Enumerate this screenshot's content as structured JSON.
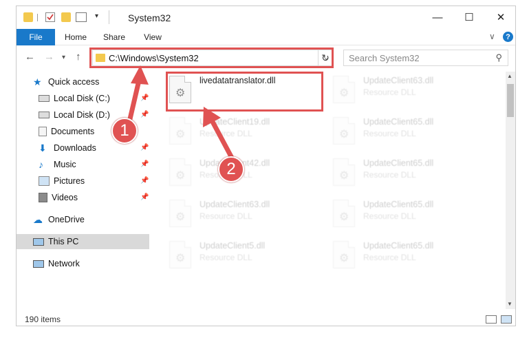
{
  "titlebar": {
    "title": "System32",
    "minimize": "—",
    "maximize": "☐",
    "close": "✕"
  },
  "ribbon": {
    "tabs": [
      "File",
      "Home",
      "Share",
      "View"
    ],
    "help": "?",
    "expand": "∨"
  },
  "address": {
    "path": "C:\\Windows\\System32",
    "search_placeholder": "Search System32"
  },
  "sidebar": {
    "items": [
      {
        "label": "Quick access",
        "icon": "star-icon"
      },
      {
        "label": "Local Disk (C:)",
        "icon": "drive-icon"
      },
      {
        "label": "Local Disk (D:)",
        "icon": "drive-icon"
      },
      {
        "label": "Documents",
        "icon": "documents-icon"
      },
      {
        "label": "Downloads",
        "icon": "download-icon"
      },
      {
        "label": "Music",
        "icon": "music-icon"
      },
      {
        "label": "Pictures",
        "icon": "pictures-icon"
      },
      {
        "label": "Videos",
        "icon": "videos-icon"
      },
      {
        "label": "OneDrive",
        "icon": "cloud-icon"
      },
      {
        "label": "This PC",
        "icon": "computer-icon"
      },
      {
        "label": "Network",
        "icon": "network-icon"
      }
    ]
  },
  "files": {
    "highlighted": {
      "name": "livedatatranslator.dll"
    },
    "items": [
      {
        "name": "UpdateClient63.dll",
        "type": "Resource DLL"
      },
      {
        "name": "UpdateClient19.dll",
        "type": "Resource DLL"
      },
      {
        "name": "UpdateClient65.dll",
        "type": "Resource DLL"
      },
      {
        "name": "UpdateClient42.dll",
        "type": "Resource DLL"
      },
      {
        "name": "UpdateClient65.dll",
        "type": "Resource DLL"
      },
      {
        "name": "UpdateClient63.dll",
        "type": "Resource DLL"
      },
      {
        "name": "UpdateClient65.dll",
        "type": "Resource DLL"
      },
      {
        "name": "UpdateClient5.dll",
        "type": "Resource DLL"
      },
      {
        "name": "UpdateClient65.dll",
        "type": "Resource DLL"
      }
    ]
  },
  "status": {
    "count": "190 items"
  },
  "annotations": {
    "step1": "1",
    "step2": "2"
  },
  "colors": {
    "accent": "#1979ca",
    "annotation": "#e05252",
    "folder": "#f3c94e"
  }
}
